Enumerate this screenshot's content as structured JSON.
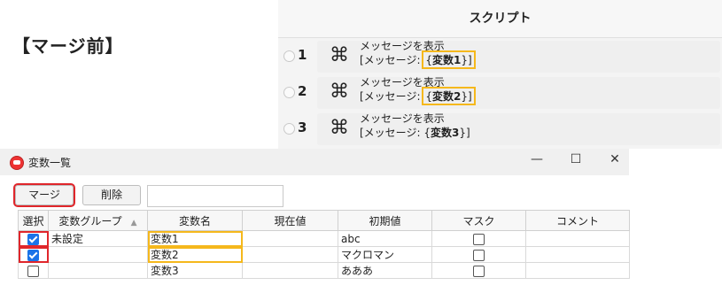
{
  "heading": "【マージ前】",
  "script": {
    "header": "スクリプト",
    "steps": [
      {
        "num": "1",
        "action": "メッセージを表示",
        "param_prefix": "[メッセージ:",
        "var_open": "{",
        "var_name": "変数1",
        "var_close": "}]",
        "highlighted": true
      },
      {
        "num": "2",
        "action": "メッセージを表示",
        "param_prefix": "[メッセージ:",
        "var_open": "{",
        "var_name": "変数2",
        "var_close": "}]",
        "highlighted": true
      },
      {
        "num": "3",
        "action": "メッセージを表示",
        "param_prefix": "[メッセージ:",
        "var_open": "{",
        "var_name": "変数3",
        "var_close": "}]",
        "highlighted": false
      }
    ],
    "command_icon": "⌘"
  },
  "window": {
    "title": "変数一覧",
    "controls": {
      "minimize": "—",
      "maximize": "☐",
      "close": "✕"
    },
    "toolbar": {
      "merge_label": "マージ",
      "delete_label": "削除",
      "filter_value": ""
    },
    "columns": [
      "選択",
      "変数グループ",
      "変数名",
      "現在値",
      "初期値",
      "マスク",
      "コメント"
    ],
    "rows": [
      {
        "selected": true,
        "group": "未設定",
        "name": "変数1",
        "current": "",
        "initial": "abc",
        "mask": false,
        "comment": ""
      },
      {
        "selected": true,
        "group": "",
        "name": "変数2",
        "current": "",
        "initial": "マクロマン",
        "mask": false,
        "comment": ""
      },
      {
        "selected": false,
        "group": "",
        "name": "変数3",
        "current": "",
        "initial": "あああ",
        "mask": false,
        "comment": ""
      }
    ]
  },
  "colors": {
    "highlight_yellow": "#f5b81c",
    "highlight_red": "#e0262b",
    "check_blue": "#1b73e8"
  }
}
